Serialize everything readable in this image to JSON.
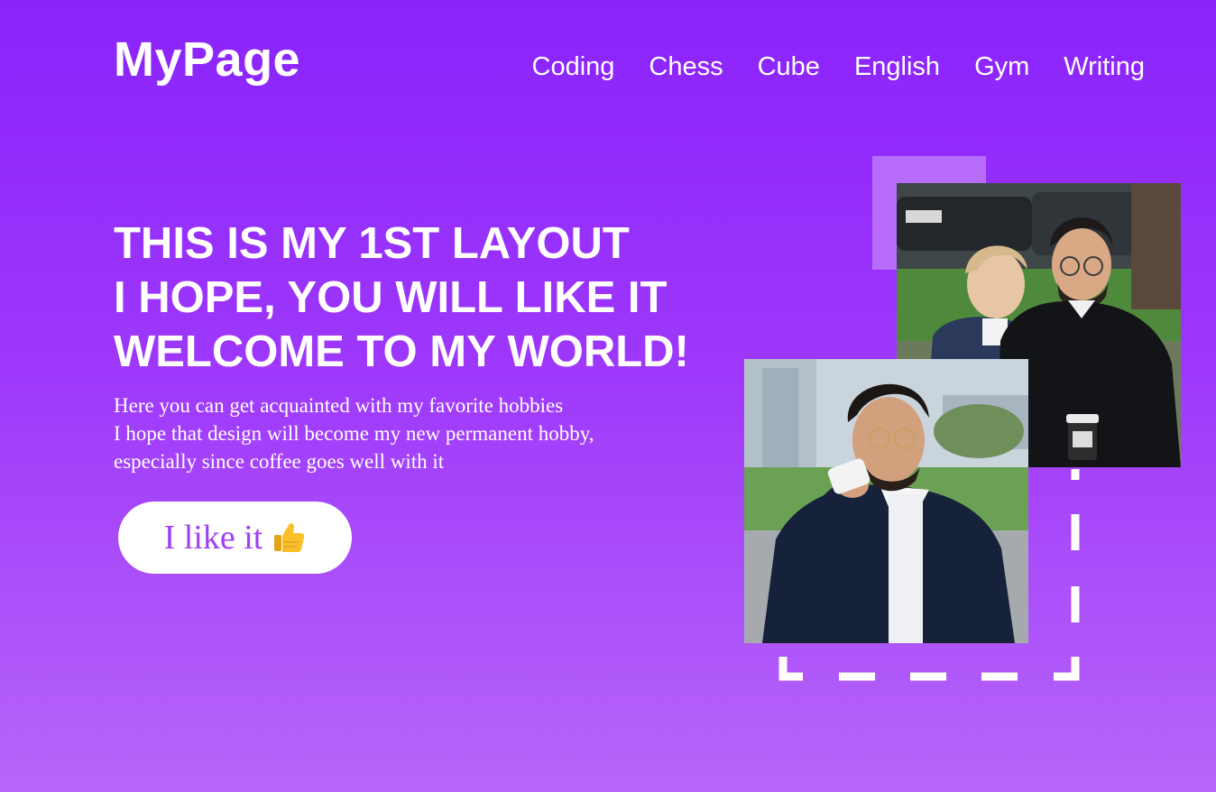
{
  "header": {
    "logo": "MyPage",
    "nav": [
      "Coding",
      "Chess",
      "Cube",
      "English",
      "Gym",
      "Writing"
    ]
  },
  "hero": {
    "title_lines": [
      "THIS IS MY 1ST LAYOUT",
      "I HOPE, YOU WILL LIKE IT",
      "WELCOME TO MY WORLD!"
    ],
    "text_lines": [
      "Here you can get acquainted with my favorite hobbies",
      "I hope that design will become my new permanent hobby,",
      "especially since coffee goes well with it"
    ],
    "button_label": "I like it",
    "button_icon": "thumbs-up-icon"
  },
  "colors": {
    "background_top": "#8a23fb",
    "background_bottom": "#b765f9",
    "button_text": "#a13ff4",
    "deco_square": "#b86cfa"
  }
}
